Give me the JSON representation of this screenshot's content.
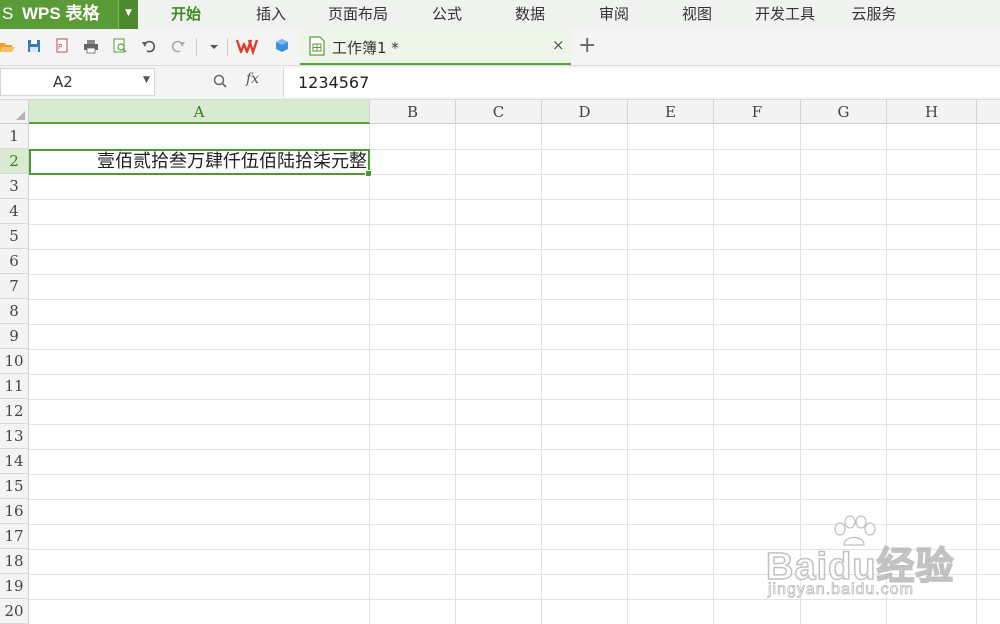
{
  "app": {
    "logo_glyph": "S",
    "name": "WPS 表格"
  },
  "menu": {
    "items": [
      {
        "label": "开始",
        "active": true
      },
      {
        "label": "插入"
      },
      {
        "label": "页面布局"
      },
      {
        "label": "公式"
      },
      {
        "label": "数据"
      },
      {
        "label": "审阅"
      },
      {
        "label": "视图"
      },
      {
        "label": "开发工具"
      },
      {
        "label": "云服务"
      }
    ]
  },
  "quick_access": [
    "open-icon",
    "save-icon",
    "export-pdf-icon",
    "print-icon",
    "print-preview-icon",
    "undo-icon",
    "redo-icon",
    "customize-dropdown-icon",
    "wps-icon",
    "cloud-cube-icon"
  ],
  "document_tab": {
    "title": "工作簿1 *",
    "close_glyph": "×",
    "new_tab_glyph": "+"
  },
  "formula_bar": {
    "name_box": "A2",
    "fx_label": "fx",
    "formula": "1234567"
  },
  "sheet": {
    "columns": [
      "A",
      "B",
      "C",
      "D",
      "E",
      "F",
      "G",
      "H"
    ],
    "rows": [
      "1",
      "2",
      "3",
      "4",
      "5",
      "6",
      "7",
      "8",
      "9",
      "10",
      "11",
      "12",
      "13",
      "14",
      "15",
      "16",
      "17",
      "18",
      "19",
      "20"
    ],
    "selected_column": "A",
    "selected_row": "2",
    "cells": {
      "A2": "壹佰贰拾叁万肆仟伍佰陆拾柒元整"
    }
  },
  "watermark": {
    "brand": "Baidu经验",
    "url": "jingyan.baidu.com"
  },
  "colors": {
    "accent": "#5a9a37",
    "selection": "#4e9a2e",
    "header_bg": "#f3f3f3"
  }
}
